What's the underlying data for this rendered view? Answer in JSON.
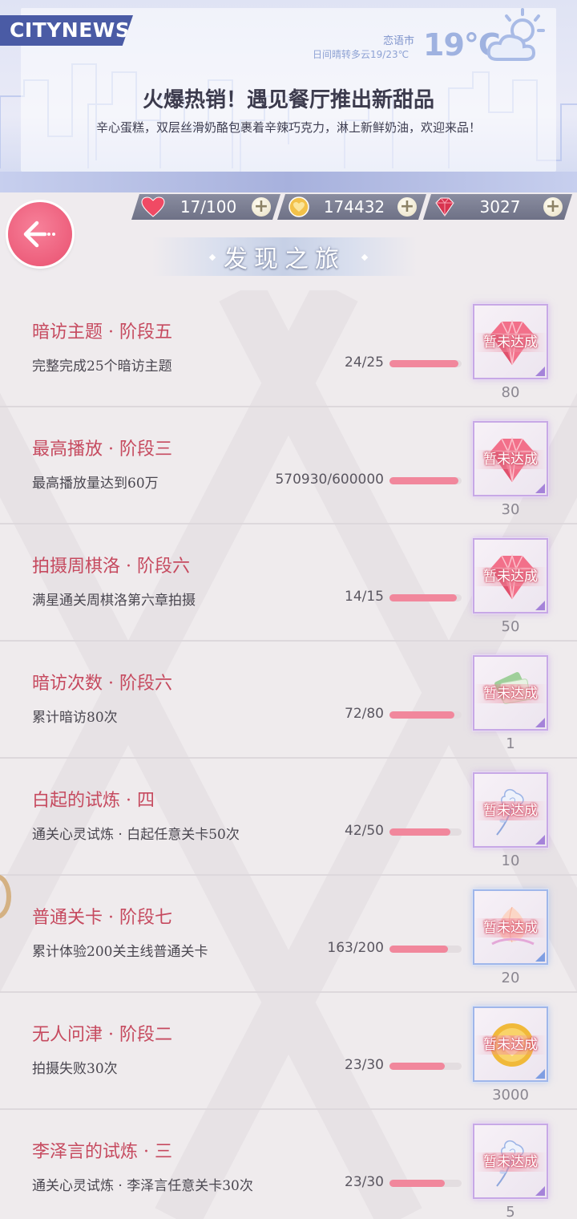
{
  "header": {
    "logo": "CITYNEWS",
    "weather": {
      "city": "恋语市",
      "description": "日间晴转多云19/23℃",
      "temperature": "19°C",
      "icon": "partly-cloudy-icon"
    },
    "headline": "火爆热销！遇见餐厅推出新甜品",
    "subline": "辛心蛋糕，双层丝滑奶酪包裹着辛辣巧克力，淋上新鲜奶油，欢迎来品！"
  },
  "currency": [
    {
      "icon": "heart-icon",
      "value": "17/100"
    },
    {
      "icon": "coin-icon",
      "value": "174432"
    },
    {
      "icon": "diamond-icon",
      "value": "3027"
    }
  ],
  "nav": {
    "back_icon": "back-arrow-icon",
    "title": "发现之旅"
  },
  "colors": {
    "accent": "#c64a5f",
    "progress_fill": "#f1879c",
    "progress_track": "#e3dde0",
    "logo_bg": "#4a5ba5"
  },
  "achievements": [
    {
      "title": "暗访主题 · 阶段五",
      "desc": "完整完成25个暗访主题",
      "progress": "24/25",
      "ratio": 0.96,
      "reward_icon": "diamond-icon",
      "reward_status": "暂未达成",
      "reward_qty": "80",
      "frame": "purple"
    },
    {
      "title": "最高播放 · 阶段三",
      "desc": "最高播放量达到60万",
      "progress": "570930/600000",
      "ratio": 0.95,
      "reward_icon": "diamond-icon",
      "reward_status": "暂未达成",
      "reward_qty": "30",
      "frame": "purple"
    },
    {
      "title": "拍摄周棋洛 · 阶段六",
      "desc": "满星通关周棋洛第六章拍摄",
      "progress": "14/15",
      "ratio": 0.93,
      "reward_icon": "diamond-icon",
      "reward_status": "暂未达成",
      "reward_qty": "50",
      "frame": "purple"
    },
    {
      "title": "暗访次数 · 阶段六",
      "desc": "累计暗访80次",
      "progress": "72/80",
      "ratio": 0.9,
      "reward_icon": "ticket-icon",
      "reward_status": "暂未达成",
      "reward_qty": "1",
      "frame": "purple"
    },
    {
      "title": "白起的试炼 · 四",
      "desc": "通关心灵试炼 · 白起任意关卡50次",
      "progress": "42/50",
      "ratio": 0.84,
      "reward_icon": "rose-icon",
      "reward_status": "暂未达成",
      "reward_qty": "10",
      "frame": "purple"
    },
    {
      "title": "普通关卡 · 阶段七",
      "desc": "累计体验200关主线普通关卡",
      "progress": "163/200",
      "ratio": 0.815,
      "reward_icon": "crystal-icon",
      "reward_status": "暂未达成",
      "reward_qty": "20",
      "frame": "blue"
    },
    {
      "title": "无人问津 · 阶段二",
      "desc": "拍摄失败30次",
      "progress": "23/30",
      "ratio": 0.767,
      "reward_icon": "coin-icon",
      "reward_status": "暂未达成",
      "reward_qty": "3000",
      "frame": "blue"
    },
    {
      "title": "李泽言的试炼 · 三",
      "desc": "通关心灵试炼 · 李泽言任意关卡30次",
      "progress": "23/30",
      "ratio": 0.767,
      "reward_icon": "rose-icon",
      "reward_status": "暂未达成",
      "reward_qty": "5",
      "frame": "purple"
    }
  ]
}
